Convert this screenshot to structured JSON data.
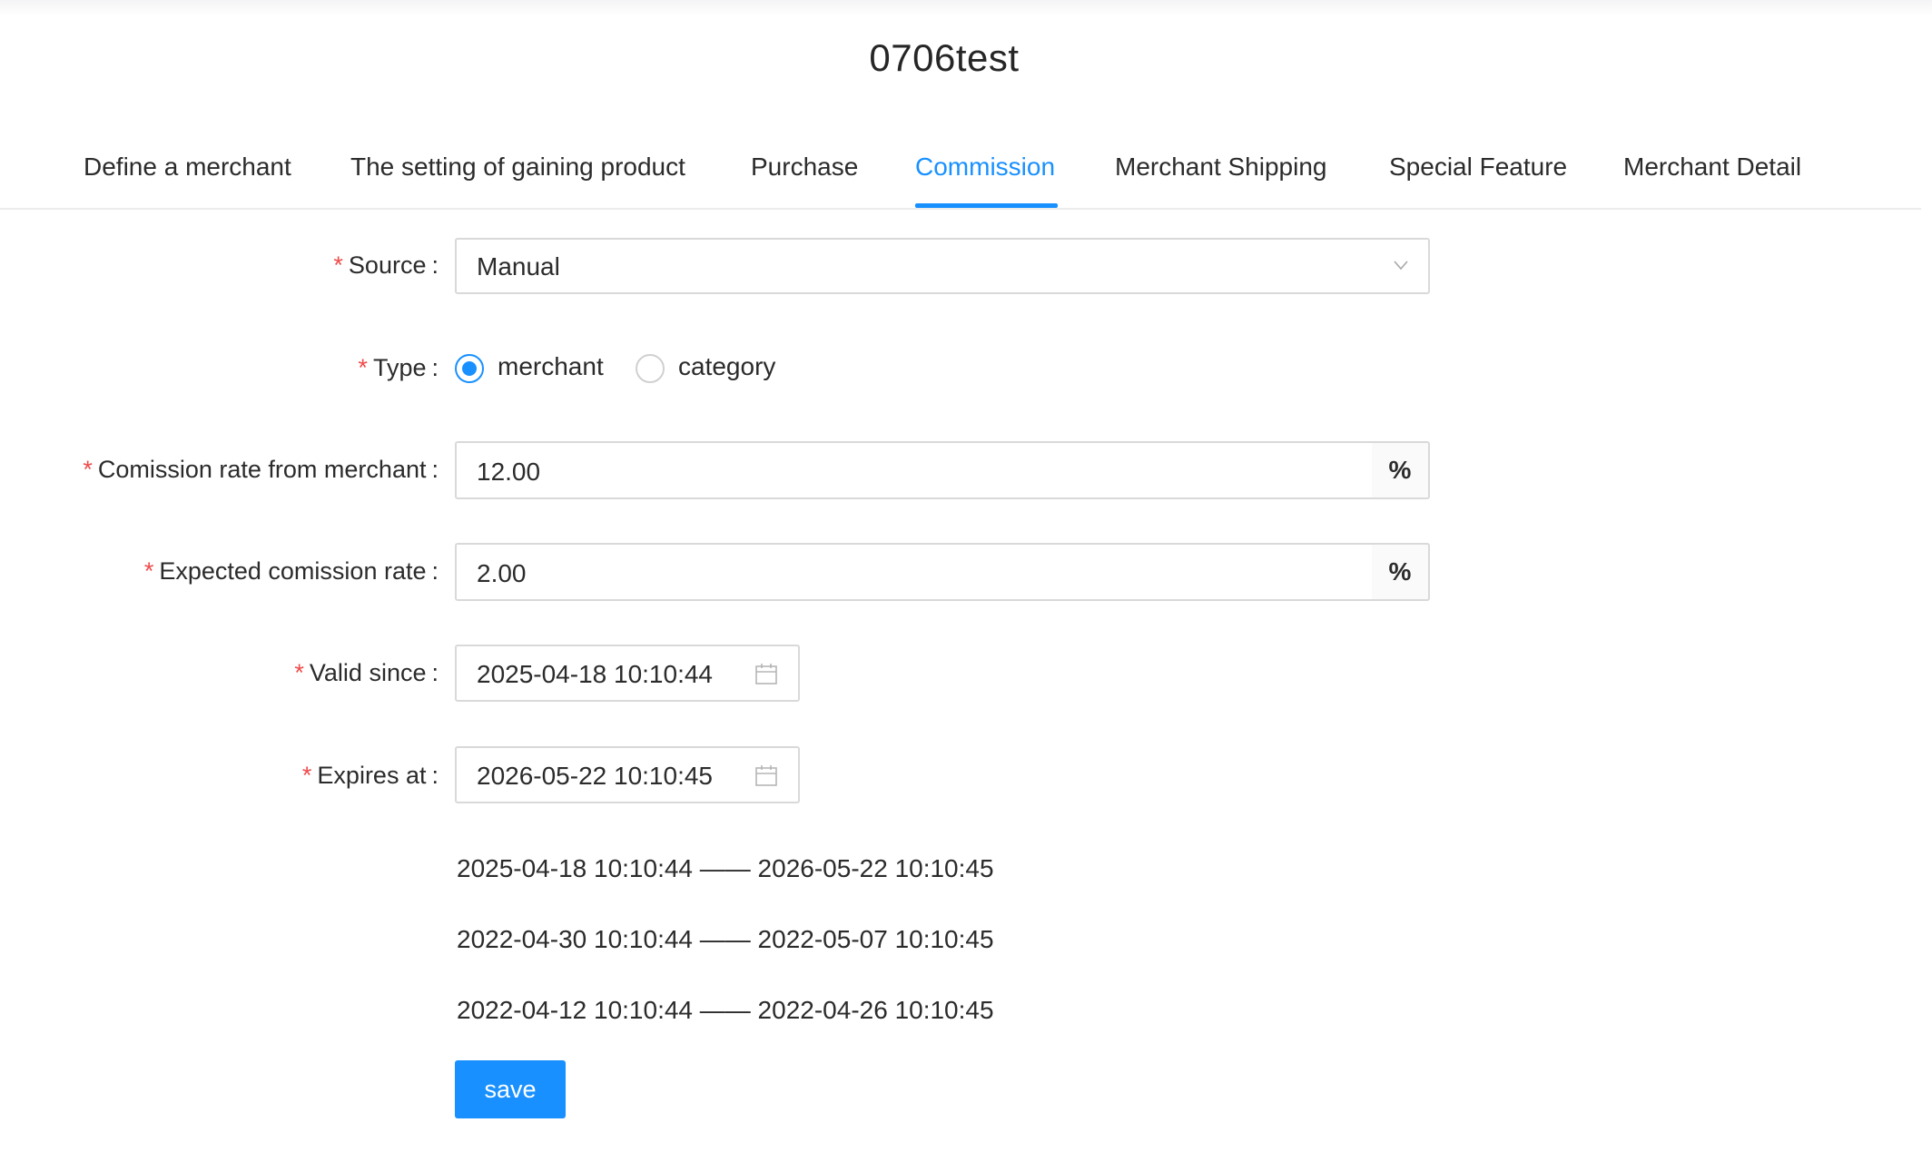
{
  "title": "0706test",
  "tabs": [
    {
      "label": "Define a merchant"
    },
    {
      "label": "The setting of gaining product"
    },
    {
      "label": "Purchase"
    },
    {
      "label": "Commission",
      "active": true
    },
    {
      "label": "Merchant Shipping"
    },
    {
      "label": "Special Feature"
    },
    {
      "label": "Merchant Detail"
    }
  ],
  "form": {
    "required_mark": "*",
    "colon": ":",
    "source": {
      "label": "Source",
      "value": "Manual"
    },
    "type": {
      "label": "Type",
      "options": [
        {
          "label": "merchant",
          "checked": true
        },
        {
          "label": "category",
          "checked": false
        }
      ]
    },
    "merchant_rate": {
      "label": "Comission rate from merchant",
      "value": "12.00",
      "unit": "%"
    },
    "expected_rate": {
      "label": "Expected comission rate",
      "value": "2.00",
      "unit": "%"
    },
    "valid_since": {
      "label": "Valid since",
      "value": "2025-04-18 10:10:44"
    },
    "expires_at": {
      "label": "Expires at",
      "value": "2026-05-22 10:10:45"
    }
  },
  "ranges": [
    "2025-04-18 10:10:44 —— 2026-05-22 10:10:45",
    "2022-04-30 10:10:44 —— 2022-05-07 10:10:45",
    "2022-04-12 10:10:44 —— 2022-04-26 10:10:45"
  ],
  "actions": {
    "save_label": "save"
  },
  "colors": {
    "accent": "#1890ff",
    "required": "#ef4b4b",
    "border": "#d9d9d9"
  },
  "icons": {
    "select": "chevron-down-icon",
    "date": "calendar-icon"
  }
}
